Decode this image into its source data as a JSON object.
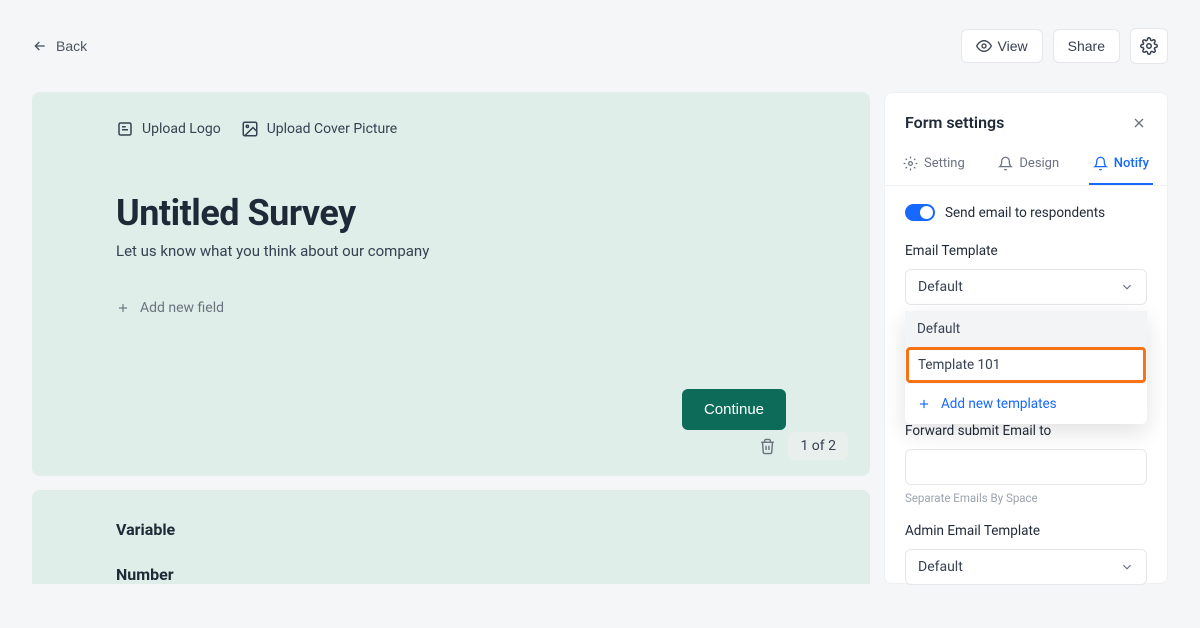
{
  "topbar": {
    "back_label": "Back",
    "view_label": "View",
    "share_label": "Share"
  },
  "form": {
    "upload_logo_label": "Upload Logo",
    "upload_cover_label": "Upload Cover Picture",
    "title": "Untitled Survey",
    "subtitle": "Let us know what you think about our company",
    "add_field_label": "Add new field",
    "continue_label": "Continue",
    "page_indicator": "1 of 2",
    "fields": {
      "variable_label": "Variable",
      "number_label": "Number"
    }
  },
  "sidebar": {
    "title": "Form settings",
    "tabs": {
      "setting": "Setting",
      "design": "Design",
      "notify": "Notify"
    },
    "notify": {
      "toggle_label": "Send email to respondents",
      "email_template_label": "Email Template",
      "email_template_selected": "Default",
      "dropdown_options": {
        "default": "Default",
        "template101": "Template 101",
        "add_new": "Add new templates"
      },
      "forward_label": "Forward submit Email to",
      "forward_hint": "Separate Emails By Space",
      "admin_template_label": "Admin Email Template",
      "admin_template_selected": "Default"
    }
  }
}
